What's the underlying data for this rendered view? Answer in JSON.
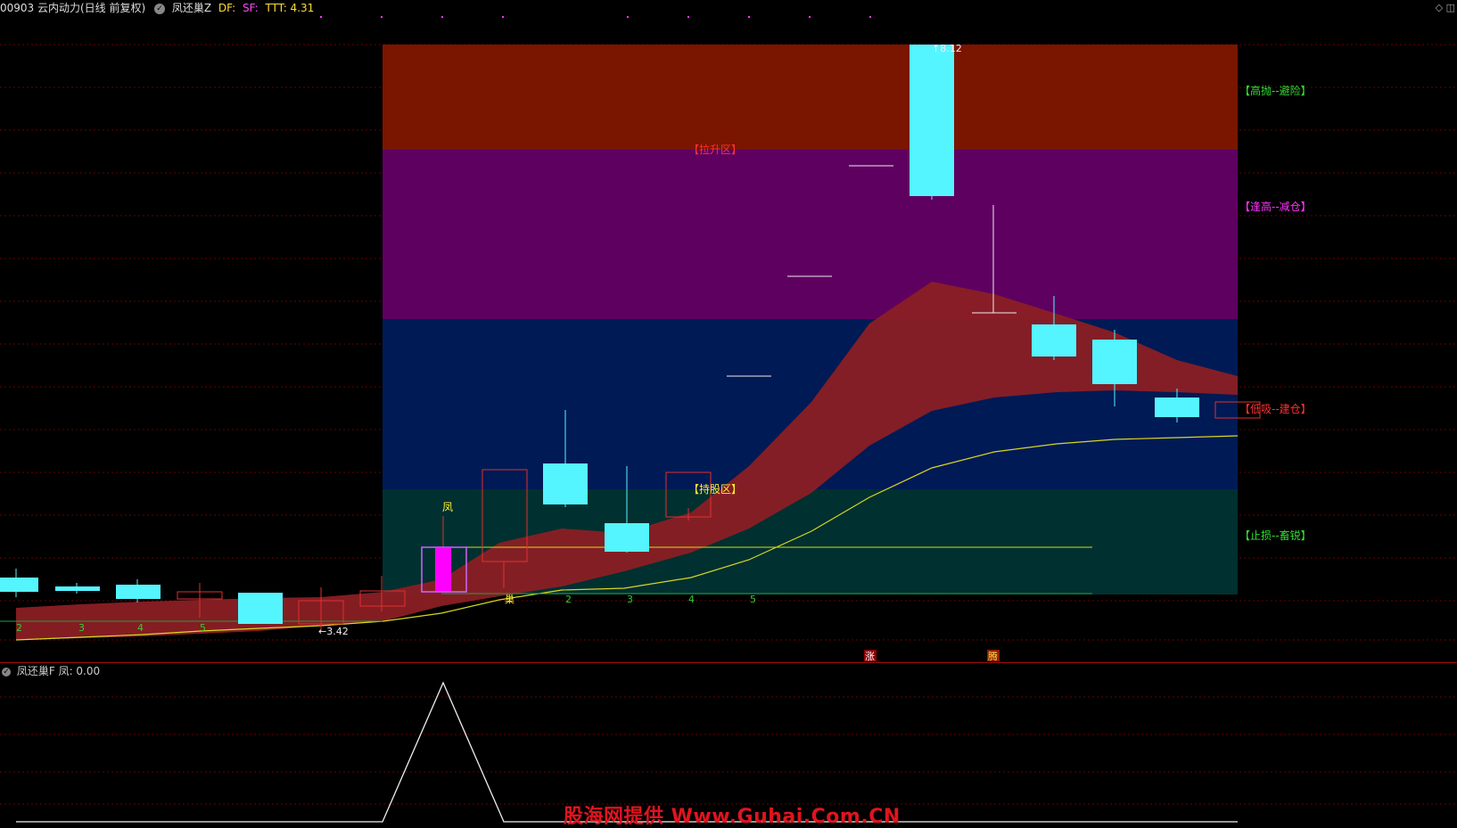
{
  "header": {
    "stock_title": "00903 云内动力(日线 前复权)",
    "indicator_name": "凤还巢Z",
    "df_label": "DF:",
    "sf_label": "SF:",
    "ttt_label": "TTT: 4.31"
  },
  "zones": {
    "right_labels": [
      "【高抛--避险】",
      "【逢高--减仓】",
      "【低吸--建仓】",
      "【止损--畜锐】"
    ],
    "center_labels": [
      "【拉升区】",
      "【持股区】"
    ]
  },
  "markers": {
    "feng": "凤",
    "chao": "巢",
    "zhang": "涨",
    "teng": "腾",
    "low_price": "←3.42",
    "high_price": "↑8.12"
  },
  "counts": {
    "left_row": [
      "2",
      "3",
      "4",
      "5"
    ],
    "right_row": [
      "2",
      "3",
      "4",
      "5"
    ]
  },
  "subpanel": {
    "title": "凤还巢F",
    "value_label": "凤: 0.00"
  },
  "watermark": "股海网提供 Www.Guhai.Com.CN",
  "colors": {
    "zone_high": "#7a1500",
    "zone_reduce": "#5e0060",
    "zone_hold": "#001a55",
    "zone_stop": "#003030",
    "cyan_candle": "#55f5ff",
    "band": "#8a1f24",
    "ma_yellow": "#d8d820",
    "grid_red": "#7a0000"
  },
  "icons": [
    "diamond-icon",
    "expand-icon",
    "indicator-toggle-icon"
  ]
}
